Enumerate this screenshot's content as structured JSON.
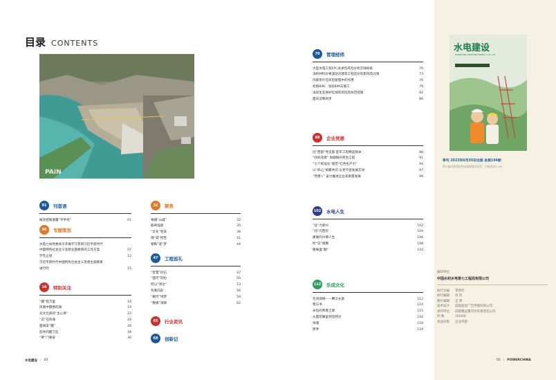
{
  "header": {
    "title_zh": "目录",
    "title_en": "CONTENTS"
  },
  "photo": {
    "credit": "PAIN"
  },
  "sections": [
    {
      "id": "kanshouyu",
      "num": "01",
      "color": "#1c5a9c",
      "title": "刊首语",
      "items": [
        {
          "t": "植逆担铭遒露“平半经”",
          "p": "01"
        }
      ]
    },
    {
      "id": "zhuanti",
      "num": "06",
      "color": "#e07a2a",
      "title": "专题策划",
      "items": [
        {
          "t": "水电七局党委关于开展学习贯彻习近平新时代",
          "p": ""
        },
        {
          "t": "中国特色社会主义思想主题教育的工作方案",
          "p": "07"
        },
        {
          "t": "学无止境",
          "p": "12"
        },
        {
          "t": "习近平新时代中国特色社会主义思想主题教育",
          "p": ""
        },
        {
          "t": "进行时",
          "p": "15"
        }
      ]
    },
    {
      "id": "tebie",
      "num": "16",
      "color": "#c8322f",
      "title": "特别关注",
      "items": [
        {
          "t": "“疆”程万里",
          "p": "16"
        },
        {
          "t": "凤凰中飘扬的旗",
          "p": "19"
        },
        {
          "t": "光文允岗的“主心骨”",
          "p": "22"
        },
        {
          "t": "“志”在四海",
          "p": "24"
        },
        {
          "t": "面阔美“疆”",
          "p": "26"
        },
        {
          "t": "彭呼的磨刀石",
          "p": "28"
        },
        {
          "t": "“帝”门要安",
          "p": "30"
        }
      ]
    },
    {
      "id": "jujiao",
      "num": "32",
      "color": "#e07a2a",
      "title": "聚焦",
      "items": [
        {
          "t": "根播“山城”",
          "p": "32"
        },
        {
          "t": "筋骨强基",
          "p": "35"
        },
        {
          "t": "“云冬”智安",
          "p": "38"
        },
        {
          "t": "博“城”所至",
          "p": "41"
        },
        {
          "t": "钢铁“逐”梦",
          "p": "44"
        }
      ]
    },
    {
      "id": "gongcheng",
      "num": "47",
      "color": "#1c5a9c",
      "title": "工程巡礼",
      "items": [
        {
          "t": "“智慧”砂石",
          "p": "47"
        },
        {
          "t": "“面河”同拉",
          "p": "50"
        },
        {
          "t": "何以“领注”",
          "p": "53"
        },
        {
          "t": "负重向前",
          "p": "56"
        },
        {
          "t": "“桐河”绿梦",
          "p": "59"
        },
        {
          "t": "“数媒”演绎",
          "p": "62"
        }
      ]
    },
    {
      "id": "hangye",
      "num": "65",
      "color": "#c8322f",
      "title": "行业资讯",
      "items": []
    },
    {
      "id": "chuangxin",
      "num": "68",
      "color": "#1c5a9c",
      "title": "创新记",
      "items": []
    },
    {
      "id": "guanli",
      "num": "70",
      "color": "#1c5a9c",
      "title": "管理经纬",
      "items": [
        {
          "t": "大型水电工程EPC总承包风险分析实践探索",
          "p": "70"
        },
        {
          "t": "浅析材料价格波动对建筑工程造价的影响及对策",
          "p": "73"
        },
        {
          "t": "内部审计在风险管理中的作用",
          "p": "76"
        },
        {
          "t": "初探BIM、浅谈BIM与施工",
          "p": "79"
        },
        {
          "t": "浅谈生态保护红线的风险及防范措施",
          "p": "82"
        },
        {
          "t": "面向法制阅步",
          "p": "86"
        }
      ]
    },
    {
      "id": "qiye",
      "num": "88",
      "color": "#c8322f",
      "title": "企业党建",
      "items": [
        {
          "t": "创“西部”党支部 匠牢工程精品铸关",
          "p": "88"
        },
        {
          "t": "“四式花建” 探嗣微升民生工程",
          "p": "91"
        },
        {
          "t": "“七个标准化”规范“红色生产力”",
          "p": "94"
        },
        {
          "t": "以“四心”搞聚共识 以党干促发展实效",
          "p": "97"
        },
        {
          "t": "“党建+” 奋力推进企业高质量发展",
          "p": "99"
        }
      ]
    },
    {
      "id": "rensheng",
      "num": "102",
      "color": "#2f3a8a",
      "title": "水电人生",
      "items": [
        {
          "t": "“驻”力新兴",
          "p": "102"
        },
        {
          "t": "“润”闪西东",
          "p": "104"
        },
        {
          "t": "藤阁的兴博人生",
          "p": "106"
        },
        {
          "t": "所“向”披靡",
          "p": "108"
        },
        {
          "t": "鹏阁喜“翻”",
          "p": "110"
        }
      ]
    },
    {
      "id": "wenhua",
      "num": "112",
      "color": "#2f9b5c",
      "title": "乐成文化",
      "items": [
        {
          "t": "在诗测德——腾汉长歌",
          "p": "112"
        },
        {
          "t": "我与书",
          "p": "114"
        },
        {
          "t": "永恒的青春之歌",
          "p": "115"
        },
        {
          "t": "从国花睡里到在网对",
          "p": "116"
        },
        {
          "t": "怅魂",
          "p": "118"
        },
        {
          "t": "原界",
          "p": "119"
        }
      ]
    }
  ],
  "cover": {
    "title": "水电建设",
    "subtitle": "POWERCHINA SINOHYDRO BUREAU 7 CO., LTD."
  },
  "issue": {
    "line": "季刊   2023年6月30日出版   总第194期",
    "sub": "四川省内部资料性出版物准印证号：川新出内2-161"
  },
  "publisher": {
    "label": "编印单位",
    "org": "中国水利水电第七工程局有限公司",
    "rows": [
      {
        "k": "执行主编",
        "v": "李燕伦"
      },
      {
        "k": "执行编辑",
        "v": "肖  凯"
      },
      {
        "k": "图片编辑",
        "v": "王  雨"
      },
      {
        "k": "美术设计",
        "v": "成都晶宣广告传播有限公司"
      },
      {
        "k": "承印单位",
        "v": "成都鑫远鑫印务有限责任公司"
      },
      {
        "k": "印      数",
        "v": "3000份"
      },
      {
        "k": "发送对象",
        "v": "企业内部"
      }
    ]
  },
  "footer": {
    "left_brand": "水电建设",
    "left_page": "04",
    "right_page": "05",
    "right_brand": "POWERCHINA"
  }
}
